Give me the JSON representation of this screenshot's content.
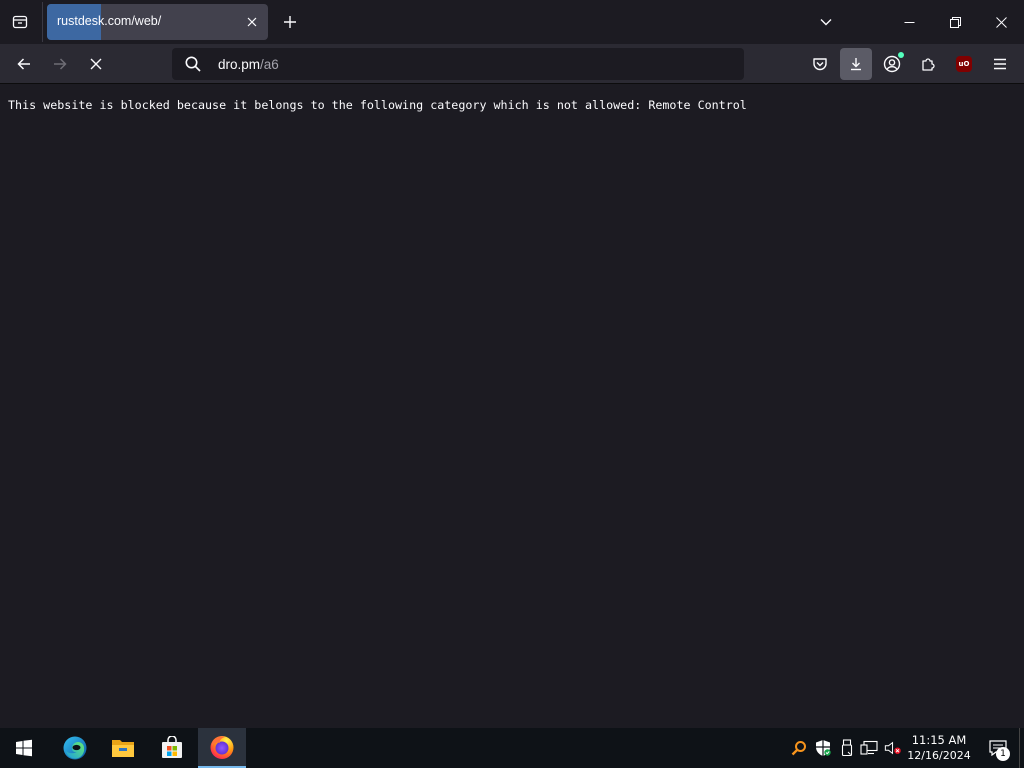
{
  "browser": {
    "tab": {
      "title": "rustdesk.com/web/"
    },
    "urlbar": {
      "host": "dro.pm",
      "path": "/a6"
    }
  },
  "page": {
    "message": "This website is blocked because it belongs to the following category which is not allowed: Remote Control"
  },
  "toolbar": {
    "ublock_label": "uO"
  },
  "taskbar": {
    "apps": [
      "start",
      "edge",
      "file-explorer",
      "microsoft-store",
      "firefox"
    ],
    "active_app": "firefox",
    "clock": {
      "time": "11:15 AM",
      "date": "12/16/2024"
    },
    "notification_count": "1"
  },
  "colors": {
    "background": "#1c1b22",
    "navbar": "#2b2a33",
    "tab": "#42414d",
    "accent": "#3d6aa6",
    "taskbar": "#0e1217"
  }
}
